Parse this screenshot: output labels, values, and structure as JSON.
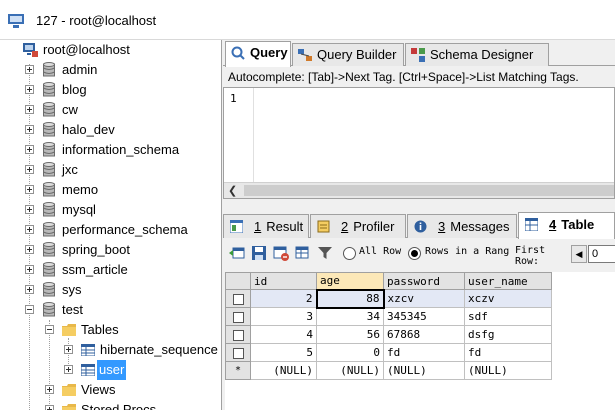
{
  "window": {
    "title": "127 - root@localhost"
  },
  "tree": {
    "root": "root@localhost",
    "databases": [
      "admin",
      "blog",
      "cw",
      "halo_dev",
      "information_schema",
      "jxc",
      "memo",
      "mysql",
      "performance_schema",
      "spring_boot",
      "ssm_article",
      "sys",
      "test"
    ],
    "tables_folder": "Tables",
    "tables": [
      "hibernate_sequence",
      "user"
    ],
    "views_folder": "Views",
    "procs_folder": "Stored Procs"
  },
  "tabs_top": {
    "query": "Query",
    "builder": "Query Builder",
    "designer": "Schema Designer"
  },
  "autocomplete": "Autocomplete: [Tab]->Next Tag. [Ctrl+Space]->List Matching Tags.",
  "editor": {
    "line": "1"
  },
  "tabs_bottom": {
    "result_num": "1",
    "result": "Result",
    "profiler_num": "2",
    "profiler": "Profiler",
    "messages_num": "3",
    "messages": "Messages",
    "tabledata_num": "4",
    "tabledata": "Table Da"
  },
  "toolbar": {
    "all_rows": "All Row",
    "rows_in_range": "Rows in a Rang",
    "first_row": "First Row:",
    "first_row_value": "0"
  },
  "grid": {
    "columns": [
      "id",
      "age",
      "password",
      "user_name"
    ],
    "rows": [
      [
        "2",
        "88",
        "xzcv",
        "xczv"
      ],
      [
        "3",
        "34",
        "345345",
        "sdf"
      ],
      [
        "4",
        "56",
        "67868",
        "dsfg"
      ],
      [
        "5",
        "0",
        "fd",
        "fd"
      ]
    ],
    "new_row": [
      "(NULL)",
      "(NULL)",
      "(NULL)",
      "(NULL)"
    ],
    "new_marker": "*"
  }
}
